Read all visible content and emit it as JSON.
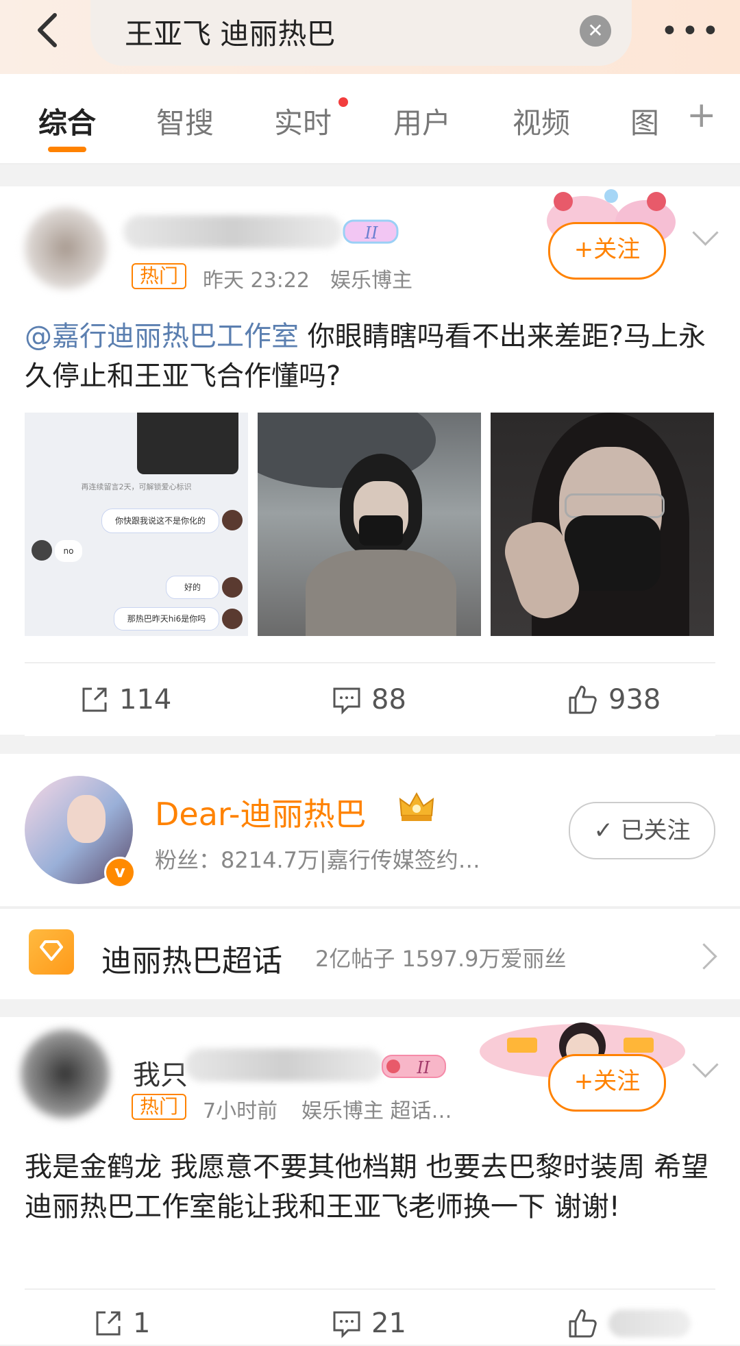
{
  "search": {
    "query": "王亚飞 迪丽热巴"
  },
  "tabs": [
    {
      "label": "综合"
    },
    {
      "label": "智搜"
    },
    {
      "label": "实时"
    },
    {
      "label": "用户"
    },
    {
      "label": "视频"
    },
    {
      "label": "图"
    }
  ],
  "post1": {
    "hot_badge": "热门",
    "time": "昨天 23:22",
    "category": "娱乐博主",
    "follow_label": "+关注",
    "mention": "@嘉行迪丽热巴工作室",
    "text": " 你眼睛瞎吗看不出来差距?马上永久停止和王亚飞合作懂吗?",
    "chat": {
      "notice": "再连续留言2天，可解锁爱心标识",
      "msg1": "你快跟我说这不是你化的",
      "msg2": "no",
      "msg3": "好的",
      "msg4": "那热巴昨天hi6是你吗"
    },
    "reposts": "114",
    "comments": "88",
    "likes": "938"
  },
  "account": {
    "name": "Dear-迪丽热巴",
    "fans": "粉丝：8214.7万|嘉行传媒签约…",
    "follow_label": "已关注",
    "verified_mark": "v"
  },
  "supertopic": {
    "name": "迪丽热巴超话",
    "stats": "2亿帖子  1597.9万爱丽丝"
  },
  "post2": {
    "hot_badge": "热门",
    "time": "7小时前",
    "category": "娱乐博主 超话…",
    "name_partial": "我只",
    "follow_label": "+关注",
    "text": "我是金鹤龙 我愿意不要其他档期 也要去巴黎时装周 希望迪丽热巴工作室能让我和王亚飞老师换一下 谢谢!",
    "reposts": "1",
    "comments": "21"
  }
}
